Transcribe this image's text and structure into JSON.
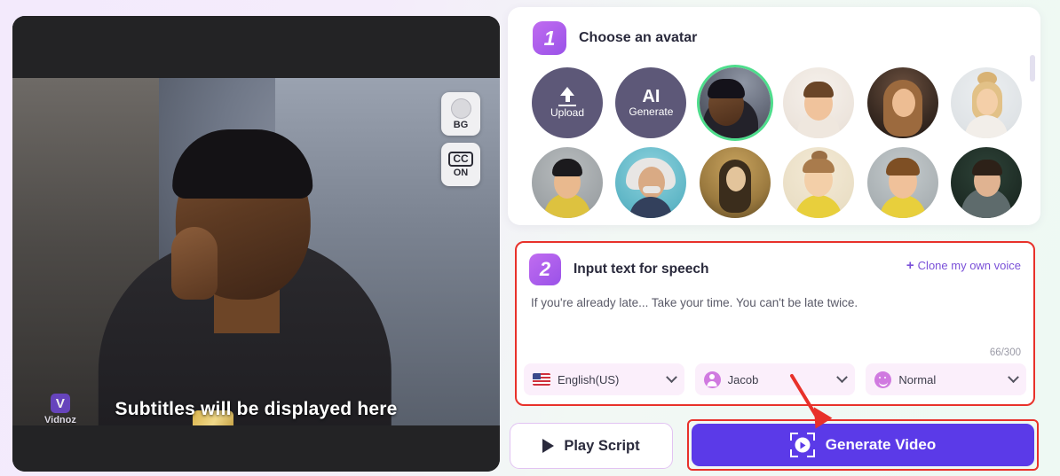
{
  "video": {
    "subtitle_text": "Subtitles will be displayed here",
    "watermark_brand": "Vidnoz",
    "watermark_logo_glyph": "V",
    "tools": [
      {
        "icon": "background-circle-icon",
        "label": "BG"
      },
      {
        "icon": "closed-caption-icon",
        "badge": "CC",
        "label": "ON"
      }
    ]
  },
  "step1": {
    "number": "1",
    "title": "Choose an avatar",
    "avatars": [
      {
        "name": "upload-avatar",
        "kind": "action",
        "icon": "upload-arrow-icon",
        "label": "Upload",
        "selected": false
      },
      {
        "name": "ai-generate-avatar",
        "kind": "action",
        "big": "AI",
        "label": "Generate",
        "selected": false
      },
      {
        "name": "avatar-real-man-thinking",
        "kind": "photo",
        "selected": true
      },
      {
        "name": "avatar-cartoon-young-man",
        "kind": "photo",
        "selected": false
      },
      {
        "name": "avatar-cartoon-long-hair-woman",
        "kind": "photo",
        "selected": false
      },
      {
        "name": "avatar-cartoon-blonde-bun-woman",
        "kind": "photo",
        "selected": false
      },
      {
        "name": "avatar-cartoon-dark-hair-boy",
        "kind": "photo",
        "selected": false
      },
      {
        "name": "avatar-einstein",
        "kind": "photo",
        "selected": false
      },
      {
        "name": "avatar-mona-lisa",
        "kind": "photo",
        "selected": false
      },
      {
        "name": "avatar-cartoon-girl-yellow",
        "kind": "photo",
        "selected": false
      },
      {
        "name": "avatar-cartoon-boy-yellow",
        "kind": "photo",
        "selected": false
      },
      {
        "name": "avatar-real-teacher-woman",
        "kind": "photo",
        "selected": false
      }
    ]
  },
  "step2": {
    "number": "2",
    "title": "Input text for speech",
    "clone_voice_label": "Clone my own voice",
    "clone_voice_plus": "+",
    "script_text": "If you're already late... Take your time. You can't be late twice.",
    "char_count": "66/300",
    "selects": [
      {
        "name": "language-select",
        "icon": "us-flag-icon",
        "value": "English(US)"
      },
      {
        "name": "voice-select",
        "icon": "person-icon",
        "value": "Jacob"
      },
      {
        "name": "tone-select",
        "icon": "smiley-icon",
        "value": "Normal"
      }
    ]
  },
  "actions": {
    "play_script_label": "Play Script",
    "generate_video_label": "Generate Video"
  },
  "colors": {
    "accent_purple": "#5b3ae8",
    "step_badge": "#9a52e8",
    "selected_ring": "#4edd8c",
    "annotation_red": "#e8312a",
    "link_purple": "#7a50d8"
  }
}
